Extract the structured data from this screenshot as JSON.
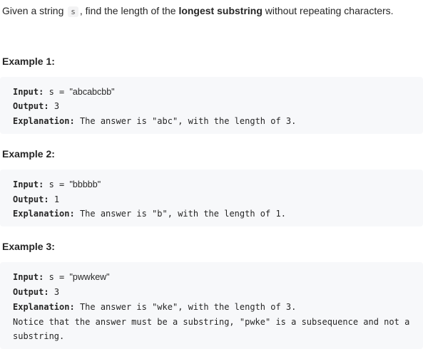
{
  "intro": {
    "prefix": "Given a string ",
    "code": "s",
    "middle": ", find the length of the ",
    "bold": "longest substring",
    "suffix": " without repeating characters."
  },
  "examples": [
    {
      "title": "Example 1:",
      "input_label": "Input:",
      "input_var": "s = ",
      "input_value": "\"abcabcbb\"",
      "output_label": "Output:",
      "output_value": "3",
      "explanation_label": "Explanation:",
      "explanation_text": "The answer is \"abc\", with the length of 3."
    },
    {
      "title": "Example 2:",
      "input_label": "Input:",
      "input_var": "s = ",
      "input_value": "\"bbbbb\"",
      "output_label": "Output:",
      "output_value": "1",
      "explanation_label": "Explanation:",
      "explanation_text": "The answer is \"b\", with the length of 1."
    },
    {
      "title": "Example 3:",
      "input_label": "Input:",
      "input_var": "s = ",
      "input_value": "\"pwwkew\"",
      "output_label": "Output:",
      "output_value": "3",
      "explanation_label": "Explanation:",
      "explanation_text": "The answer is \"wke\", with the length of 3.",
      "note_line1": "Notice that the answer must be a substring, \"pwke\" is a subsequence and not a",
      "note_line2": "substring."
    }
  ]
}
